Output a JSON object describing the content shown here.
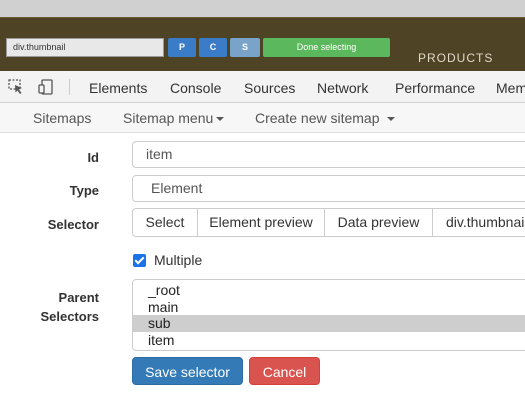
{
  "toolbar": {
    "selector_value": "div.thumbnail",
    "p_label": "P",
    "c_label": "C",
    "s_label": "S",
    "done_label": "Done selecting",
    "products_label": "PRODUCTS"
  },
  "devtools": {
    "tabs": [
      "Elements",
      "Console",
      "Sources",
      "Network",
      "Performance",
      "Mem"
    ]
  },
  "subnav": {
    "sitemaps": "Sitemaps",
    "sitemap_menu": "Sitemap menu",
    "create_sitemap": "Create new sitemap"
  },
  "form": {
    "id_label": "Id",
    "id_value": "item",
    "type_label": "Type",
    "type_value": "Element",
    "selector_label": "Selector",
    "selector_buttons": [
      "Select",
      "Element preview",
      "Data preview",
      "div.thumbnail"
    ],
    "multiple_label": "Multiple",
    "multiple_checked": true,
    "parent_label_line1": "Parent",
    "parent_label_line2": "Selectors",
    "parent_options": [
      "_root",
      "main",
      "sub",
      "item"
    ],
    "parent_selected": "sub",
    "save_label": "Save selector",
    "cancel_label": "Cancel"
  },
  "colors": {
    "site_header": "#4e4325",
    "primary": "#337ab7",
    "danger": "#d9534f",
    "success": "#5cb85c"
  }
}
